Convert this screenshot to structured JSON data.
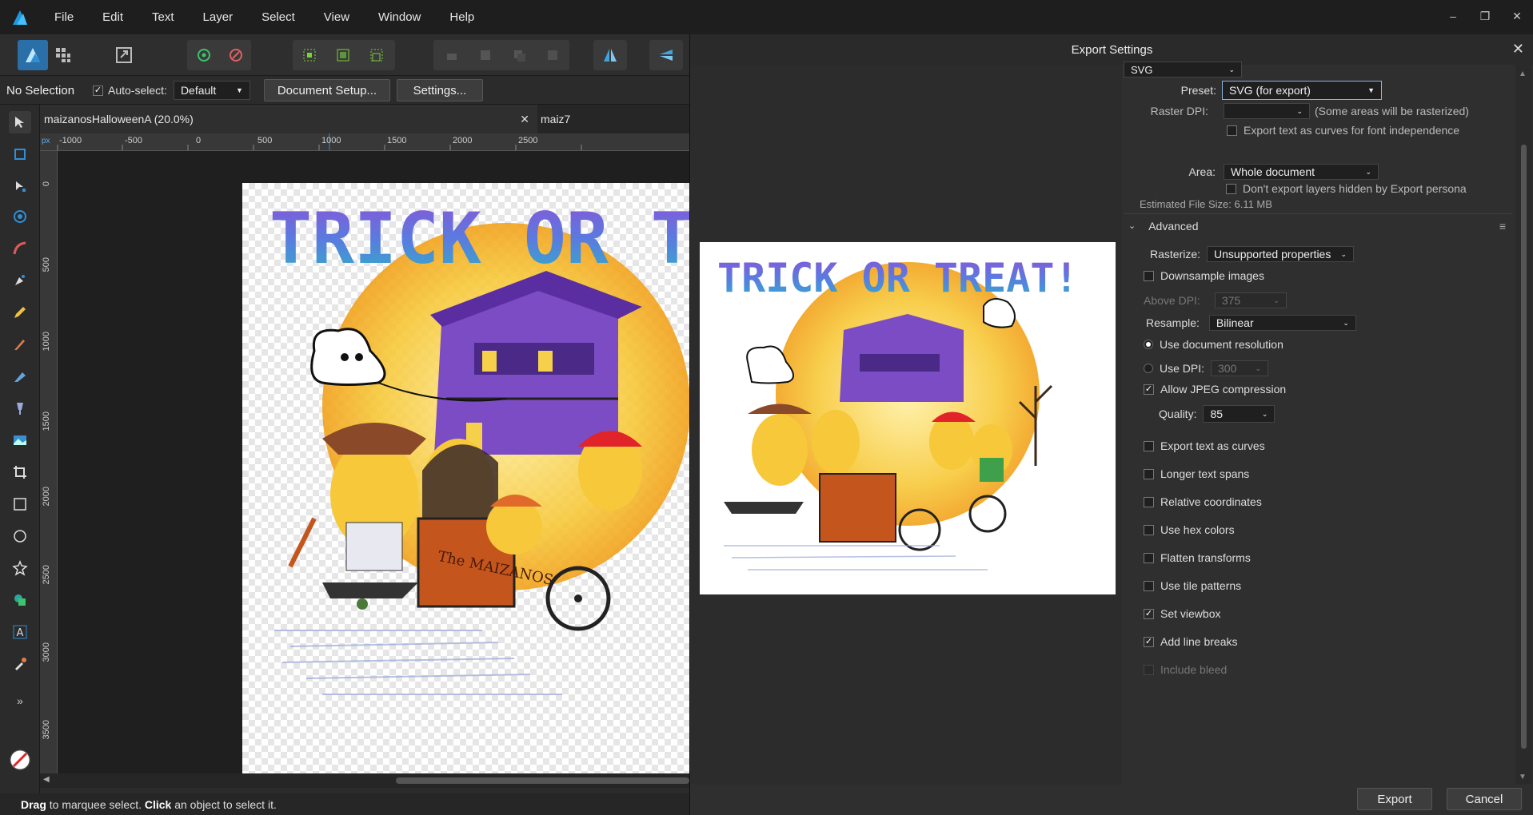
{
  "menubar": {
    "items": [
      "File",
      "Edit",
      "Text",
      "Layer",
      "Select",
      "View",
      "Window",
      "Help"
    ],
    "window_controls": [
      "–",
      "❐",
      "✕"
    ]
  },
  "context": {
    "selection_label": "No Selection",
    "autoselect_label": "Auto-select:",
    "autoselect_checked": true,
    "autoselect_value": "Default",
    "doc_setup_label": "Document Setup...",
    "settings_label": "Settings..."
  },
  "tabs": [
    {
      "label": "maizanosHalloweenA (20.0%)",
      "active": true,
      "close": "✕"
    },
    {
      "label": "maiz7",
      "active": false
    }
  ],
  "ruler": {
    "unit": "px",
    "h_ticks": [
      "-1000",
      "-500",
      "0",
      "500",
      "1000",
      "1500",
      "2000",
      "2500"
    ],
    "v_ticks": [
      "0",
      "500",
      "1000",
      "1500",
      "2000",
      "2500",
      "3000",
      "3500"
    ]
  },
  "artwork": {
    "headline": "TRICK OR TREAT!",
    "cart_label": "The MAIZANOS"
  },
  "status": {
    "drag_word": "Drag",
    "drag_text": " to marquee select. ",
    "click_word": "Click",
    "click_text": " an object to select it."
  },
  "dialog": {
    "title": "Export Settings",
    "close": "✕",
    "format": "SVG",
    "preset_label": "Preset:",
    "preset_value": "SVG (for export)",
    "raster_dpi_label": "Raster DPI:",
    "raster_dpi_value": "",
    "raster_dpi_note": "(Some areas will be rasterized)",
    "export_text_curves_font": "Export text as curves for font independence",
    "area_label": "Area:",
    "area_value": "Whole document",
    "dont_export_hidden": "Don't export layers hidden by Export persona",
    "file_size": "Estimated File Size: 6.11 MB",
    "advanced_label": "Advanced",
    "rasterize_label": "Rasterize:",
    "rasterize_value": "Unsupported properties",
    "downsample_label": "Downsample images",
    "above_dpi_label": "Above DPI:",
    "above_dpi_value": "375",
    "resample_label": "Resample:",
    "resample_value": "Bilinear",
    "use_doc_res_label": "Use document resolution",
    "use_dpi_label": "Use DPI:",
    "use_dpi_value": "300",
    "allow_jpeg_label": "Allow JPEG compression",
    "quality_label": "Quality:",
    "quality_value": "85",
    "options": [
      {
        "label": "Export text as curves",
        "checked": false,
        "enabled": true
      },
      {
        "label": "Longer text spans",
        "checked": false,
        "enabled": true
      },
      {
        "label": "Relative coordinates",
        "checked": false,
        "enabled": true
      },
      {
        "label": "Use hex colors",
        "checked": false,
        "enabled": true
      },
      {
        "label": "Flatten transforms",
        "checked": false,
        "enabled": true
      },
      {
        "label": "Use tile patterns",
        "checked": false,
        "enabled": true
      },
      {
        "label": "Set viewbox",
        "checked": true,
        "enabled": true
      },
      {
        "label": "Add line breaks",
        "checked": true,
        "enabled": true
      },
      {
        "label": "Include bleed",
        "checked": false,
        "enabled": false
      }
    ],
    "export_button": "Export",
    "cancel_button": "Cancel"
  },
  "colors": {
    "accent_blue": "#2e8fd6",
    "purple": "#7b4cc4",
    "orange": "#c4561d",
    "yellow": "#f5c830"
  }
}
